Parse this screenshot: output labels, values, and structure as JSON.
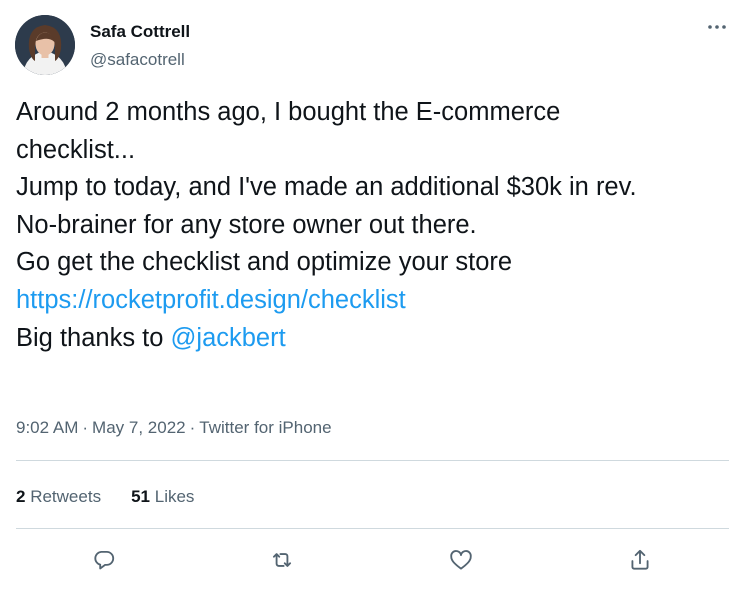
{
  "author": {
    "name": "Safa Cottrell",
    "handle": "@safacotrell",
    "avatar_icon": "profile-photo"
  },
  "more_icon": "ellipsis-icon",
  "tweet": {
    "lines": [
      "Around 2 months ago, I bought the E-commerce",
      "checklist...",
      "Jump to today, and I've made an additional $30k in rev.",
      "No-brainer for any store owner out there.",
      "Go get the checklist and optimize your store"
    ],
    "link": "https://rocketprofit.design/checklist",
    "thanks_prefix": "Big thanks to ",
    "mention": "@jackbert"
  },
  "meta": {
    "time": "9:02 AM",
    "date": "May 7, 2022",
    "source": "Twitter for iPhone",
    "separator": "·"
  },
  "stats": {
    "retweets_count": "2",
    "retweets_label": "Retweets",
    "likes_count": "51",
    "likes_label": "Likes"
  },
  "actions": [
    {
      "name": "reply",
      "icon": "reply-icon"
    },
    {
      "name": "retweet",
      "icon": "retweet-icon"
    },
    {
      "name": "like",
      "icon": "heart-icon"
    },
    {
      "name": "share",
      "icon": "share-icon"
    }
  ],
  "colors": {
    "text": "#0f1419",
    "secondary": "#536471",
    "link": "#1d9bf0",
    "divider": "#cfd9de"
  }
}
